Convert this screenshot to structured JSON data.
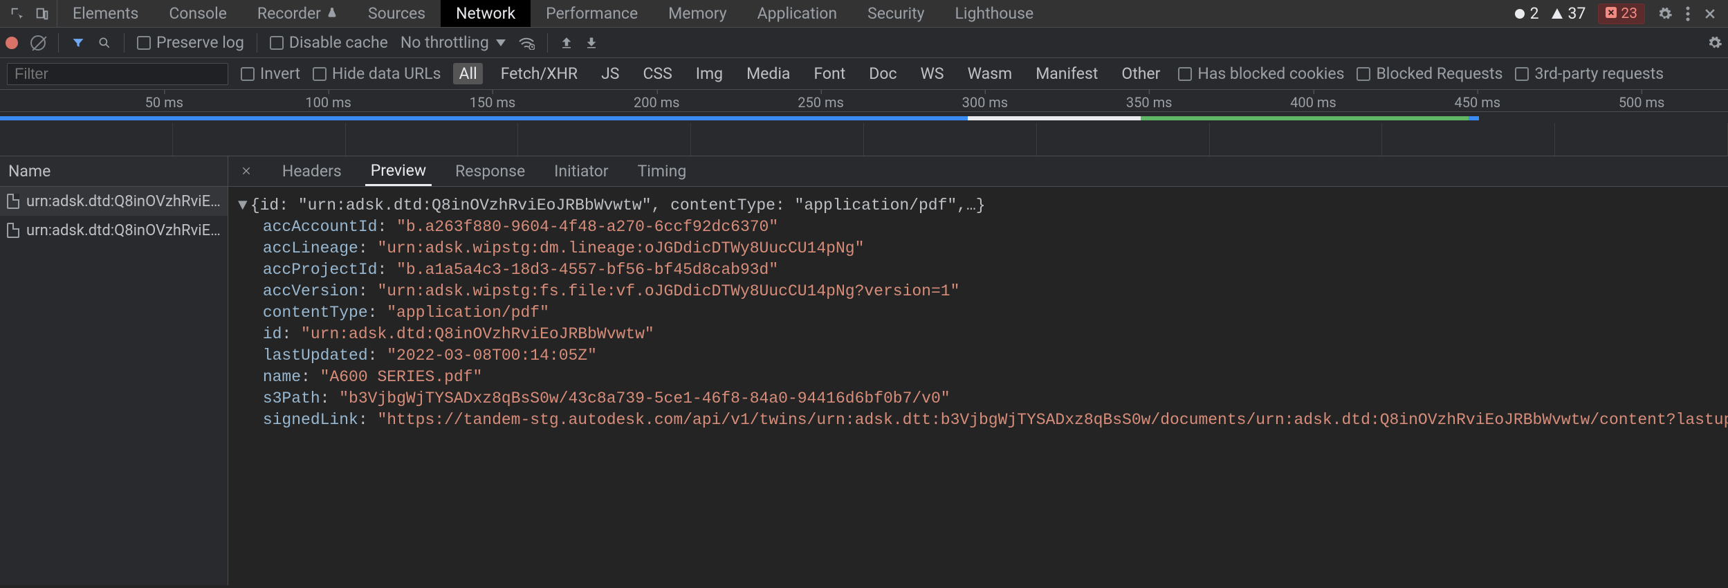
{
  "topTabs": {
    "elements": "Elements",
    "console": "Console",
    "recorder": "Recorder",
    "sources": "Sources",
    "network": "Network",
    "performance": "Performance",
    "memory": "Memory",
    "application": "Application",
    "security": "Security",
    "lighthouse": "Lighthouse"
  },
  "statusBadges": {
    "infoCount": "2",
    "warnCount": "37",
    "errorCount": "23"
  },
  "netToolbar": {
    "preserveLog": "Preserve log",
    "disableCache": "Disable cache",
    "throttling": "No throttling"
  },
  "filterBar": {
    "filterPlaceholder": "Filter",
    "invert": "Invert",
    "hideDataUrls": "Hide data URLs",
    "types": {
      "all": "All",
      "fetchxhr": "Fetch/XHR",
      "js": "JS",
      "css": "CSS",
      "img": "Img",
      "media": "Media",
      "font": "Font",
      "doc": "Doc",
      "ws": "WS",
      "wasm": "Wasm",
      "manifest": "Manifest",
      "other": "Other"
    },
    "hasBlocked": "Has blocked cookies",
    "blockedReq": "Blocked Requests",
    "thirdParty": "3rd-party requests"
  },
  "timelineTicks": [
    "50 ms",
    "100 ms",
    "150 ms",
    "200 ms",
    "250 ms",
    "300 ms",
    "350 ms",
    "400 ms",
    "450 ms",
    "500 ms"
  ],
  "leftPane": {
    "nameHeader": "Name",
    "rows": [
      "urn:adsk.dtd:Q8inOVzhRviE…",
      "urn:adsk.dtd:Q8inOVzhRviE…"
    ]
  },
  "detailTabs": {
    "headers": "Headers",
    "preview": "Preview",
    "response": "Response",
    "initiator": "Initiator",
    "timing": "Timing"
  },
  "preview": {
    "summary": "{id: \"urn:adsk.dtd:Q8inOVzhRviEoJRBbWvwtw\", contentType: \"application/pdf\",…}",
    "entries": [
      {
        "key": "accAccountId",
        "value": "\"b.a263f880-9604-4f48-a270-6ccf92dc6370\""
      },
      {
        "key": "accLineage",
        "value": "\"urn:adsk.wipstg:dm.lineage:oJGDdicDTWy8UucCU14pNg\""
      },
      {
        "key": "accProjectId",
        "value": "\"b.a1a5a4c3-18d3-4557-bf56-bf45d8cab93d\""
      },
      {
        "key": "accVersion",
        "value": "\"urn:adsk.wipstg:fs.file:vf.oJGDdicDTWy8UucCU14pNg?version=1\""
      },
      {
        "key": "contentType",
        "value": "\"application/pdf\""
      },
      {
        "key": "id",
        "value": "\"urn:adsk.dtd:Q8inOVzhRviEoJRBbWvwtw\""
      },
      {
        "key": "lastUpdated",
        "value": "\"2022-03-08T00:14:05Z\""
      },
      {
        "key": "name",
        "value": "\"A600 SERIES.pdf\""
      },
      {
        "key": "s3Path",
        "value": "\"b3VjbgWjTYSADxz8qBsS0w/43c8a739-5ce1-46f8-84a0-94416d6bf0b7/v0\""
      },
      {
        "key": "signedLink",
        "value": "\"https://tandem-stg.autodesk.com/api/v1/twins/urn:adsk.dtt:b3VjbgWjTYSADxz8qBsS0w/documents/urn:adsk.dtd:Q8inOVzhRviEoJRBbWvwtw/content?lastup"
      }
    ]
  }
}
